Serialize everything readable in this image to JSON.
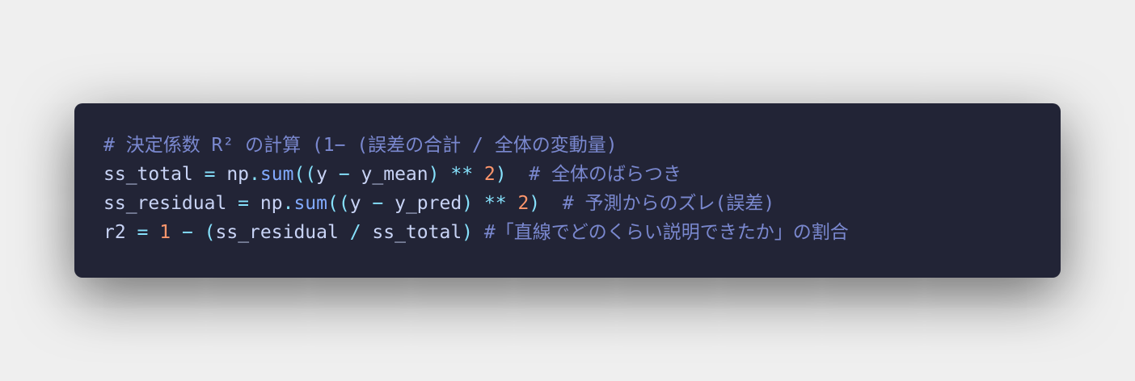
{
  "code": {
    "line1": {
      "comment": "# 決定係数 R² の計算 (1− (誤差の合計 / 全体の変動量)"
    },
    "line2": {
      "var": "ss_total",
      "eq": " = ",
      "obj": "np",
      "dot": ".",
      "func": "sum",
      "open": "((",
      "y": "y",
      "minus": " − ",
      "operand": "y_mean",
      "close": ")",
      "pow": " ** ",
      "num": "2",
      "close2": ")",
      "comment": "  # 全体のばらつき"
    },
    "line3": {
      "var": "ss_residual",
      "eq": " = ",
      "obj": "np",
      "dot": ".",
      "func": "sum",
      "open": "((",
      "y": "y",
      "minus": " − ",
      "operand": "y_pred",
      "close": ")",
      "pow": " ** ",
      "num": "2",
      "close2": ")",
      "comment": "  # 予測からのズレ(誤差)"
    },
    "line4": {
      "var": "r2",
      "eq": " = ",
      "num": "1",
      "minus": " − ",
      "open": "(",
      "a": "ss_residual",
      "div": " / ",
      "b": "ss_total",
      "close": ")",
      "comment": " #「直線でどのくらい説明できたか」の割合"
    }
  }
}
